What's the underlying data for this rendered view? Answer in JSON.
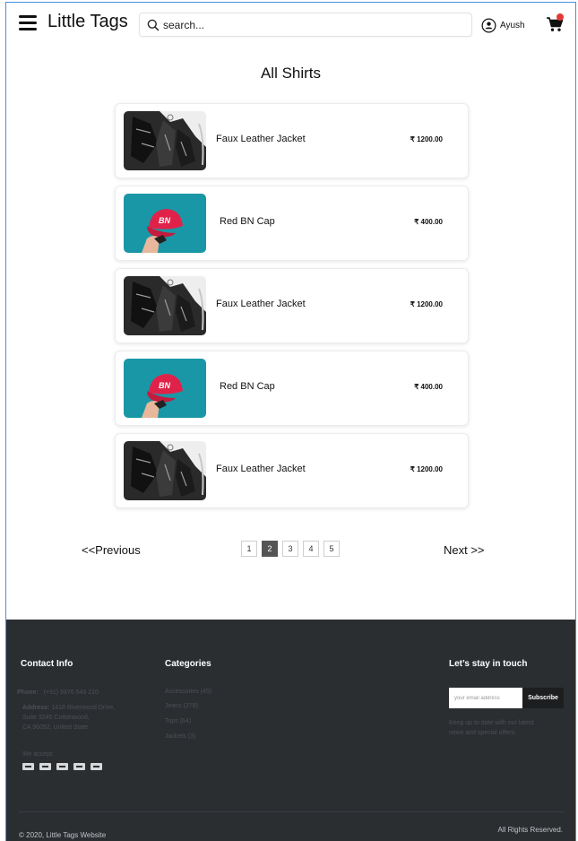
{
  "header": {
    "brand": "Little Tags",
    "search_placeholder": "search...",
    "user_name": "Ayush",
    "cart_badge_color": "#e53935"
  },
  "page_title": "All Shirts",
  "products": [
    {
      "name": "Faux Leather Jacket",
      "price": "₹ 1200.00",
      "image": "leather-jacket"
    },
    {
      "name": "Red BN Cap",
      "price": "₹ 400.00",
      "image": "red-cap"
    },
    {
      "name": "Faux Leather Jacket",
      "price": "₹ 1200.00",
      "image": "leather-jacket"
    },
    {
      "name": "Red BN Cap",
      "price": "₹ 400.00",
      "image": "red-cap"
    },
    {
      "name": "Faux Leather Jacket",
      "price": "₹ 1200.00",
      "image": "leather-jacket"
    }
  ],
  "pagination": {
    "previous": "<<Previous",
    "next": "Next >>",
    "pages": [
      "1",
      "2",
      "3",
      "4",
      "5"
    ],
    "active_page": "2"
  },
  "footer": {
    "contact": {
      "heading": "Contact Info",
      "phone_label": "Phone:",
      "phone": "(+91) 9876 543 210",
      "address_label": "Address:",
      "address_line1": "1418 Riverwood Drive,",
      "address_line2": "Suite 3245 Cottonwood,",
      "address_line3": "CA 96052, United State",
      "we_accept": "We accept:"
    },
    "categories": {
      "heading": "Categories",
      "items": [
        "Accessories (45)",
        "Jeans (278)",
        "Tops (64)",
        "Jackets (3)"
      ]
    },
    "newsletter": {
      "heading": "Let’s stay in touch",
      "email_placeholder": "your email address",
      "subscribe": "Subscribe",
      "blurb_line1": "Keep up to date with our latest",
      "blurb_line2": "news and special offers."
    },
    "copyright": "© 2020, Little Tags Website",
    "rights": "All Rights Reserved."
  },
  "colors": {
    "frame_border": "#4a90e2",
    "footer_bg": "#2b2e31",
    "active_page_bg": "#555555",
    "cap_background": "#1a97a6",
    "cap_color": "#e0224a"
  }
}
